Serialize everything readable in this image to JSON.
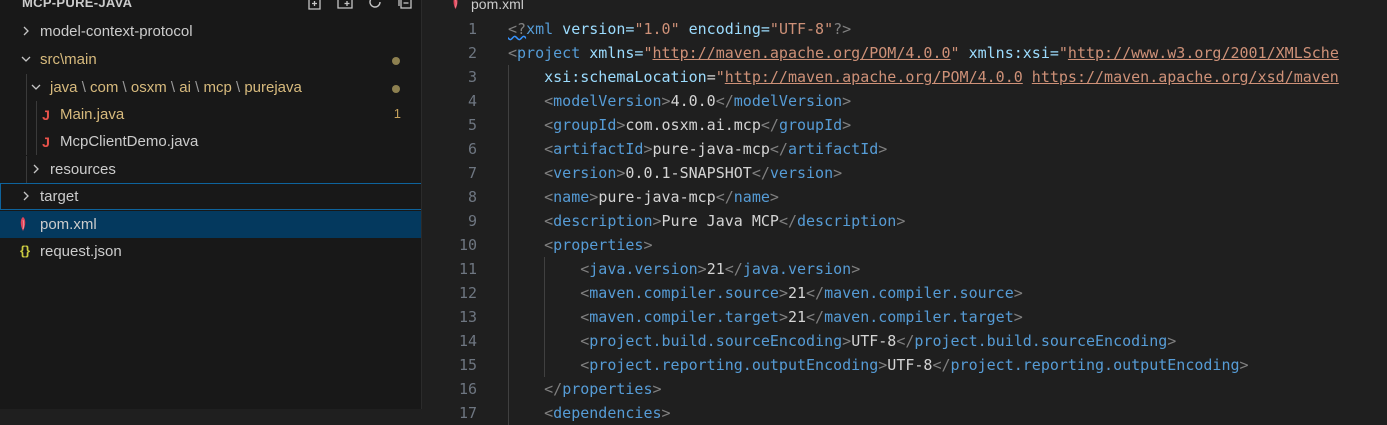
{
  "explorer": {
    "title": "MCP-PURE-JAVA",
    "actions": [
      "new-file-icon",
      "new-folder-icon",
      "refresh-icon",
      "collapse-all-icon"
    ],
    "rows": [
      {
        "name": "model-context-protocol",
        "type": "folder",
        "expanded": false
      },
      {
        "name": "src\\main",
        "type": "folder",
        "expanded": true,
        "modified": true
      },
      {
        "path": [
          "java",
          "com",
          "osxm",
          "ai",
          "mcp",
          "purejava"
        ],
        "type": "folder",
        "expanded": true,
        "modified": true
      },
      {
        "name": "Main.java",
        "type": "java",
        "modified": true,
        "problems": "1"
      },
      {
        "name": "McpClientDemo.java",
        "type": "java"
      },
      {
        "name": "resources",
        "type": "folder",
        "expanded": false
      },
      {
        "name": "target",
        "type": "folder",
        "expanded": false,
        "focused": true
      },
      {
        "name": "pom.xml",
        "type": "xml",
        "selected": true
      },
      {
        "name": "request.json",
        "type": "json"
      }
    ]
  },
  "editor": {
    "tab": {
      "label": "pom.xml",
      "icon": "maven-icon"
    },
    "lines": [
      {
        "num": "1",
        "text": "<?xml version=\"1.0\" encoding=\"UTF-8\"?>"
      },
      {
        "num": "2",
        "text": "<project xmlns=\"http://maven.apache.org/POM/4.0.0\" xmlns:xsi=\"http://www.w3.org/2001/XMLSche"
      },
      {
        "num": "3",
        "text": "    xsi:schemaLocation=\"http://maven.apache.org/POM/4.0.0 https://maven.apache.org/xsd/maven"
      },
      {
        "num": "4",
        "text": "    <modelVersion>4.0.0</modelVersion>"
      },
      {
        "num": "5",
        "text": "    <groupId>com.osxm.ai.mcp</groupId>"
      },
      {
        "num": "6",
        "text": "    <artifactId>pure-java-mcp</artifactId>"
      },
      {
        "num": "7",
        "text": "    <version>0.0.1-SNAPSHOT</version>"
      },
      {
        "num": "8",
        "text": "    <name>pure-java-mcp</name>"
      },
      {
        "num": "9",
        "text": "    <description>Pure Java MCP</description>"
      },
      {
        "num": "10",
        "text": "    <properties>"
      },
      {
        "num": "11",
        "text": "        <java.version>21</java.version>"
      },
      {
        "num": "12",
        "text": "        <maven.compiler.source>21</maven.compiler.source>"
      },
      {
        "num": "13",
        "text": "        <maven.compiler.target>21</maven.compiler.target>"
      },
      {
        "num": "14",
        "text": "        <project.build.sourceEncoding>UTF-8</project.build.sourceEncoding>"
      },
      {
        "num": "15",
        "text": "        <project.reporting.outputEncoding>UTF-8</project.reporting.outputEncoding>"
      },
      {
        "num": "16",
        "text": "    </properties>"
      },
      {
        "num": "17",
        "text": "    <dependencies>"
      }
    ]
  },
  "colors": {
    "sidebar_bg": "#181818",
    "editor_bg": "#1f1f1f",
    "selection": "#04395e",
    "focus_border": "#0e639c",
    "modified": "#d7ba7d",
    "xml_tag": "#569cd6",
    "xml_attr": "#9cdcfe",
    "xml_string": "#ce9178",
    "java_icon": "#e8524a",
    "json_icon": "#cbcb41"
  }
}
